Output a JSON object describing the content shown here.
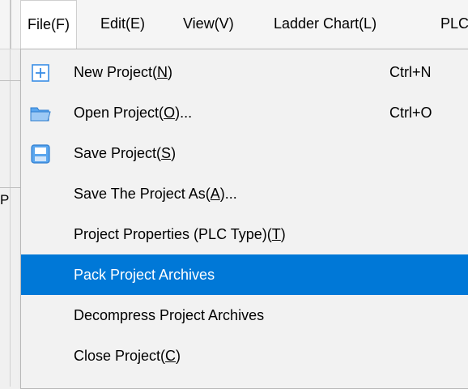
{
  "menubar": {
    "items": [
      {
        "label": "File(F)"
      },
      {
        "label": "Edit(E)"
      },
      {
        "label": "View(V)"
      },
      {
        "label": "Ladder Chart(L)"
      },
      {
        "label": "PLC"
      }
    ]
  },
  "background": {
    "letter": "P"
  },
  "file_menu": {
    "items": [
      {
        "label": "New Project(",
        "key": "N",
        "suffix": ")",
        "shortcut": "Ctrl+N",
        "icon": "new-project-icon"
      },
      {
        "label": "Open Project(",
        "key": "O",
        "suffix": ")...",
        "shortcut": "Ctrl+O",
        "icon": "folder-open-icon"
      },
      {
        "label": "Save Project(",
        "key": "S",
        "suffix": ")",
        "shortcut": "",
        "icon": "save-icon"
      },
      {
        "label": "Save The Project As(",
        "key": "A",
        "suffix": ")...",
        "shortcut": ""
      },
      {
        "label": "Project Properties (PLC Type)(",
        "key": "T",
        "suffix": ")",
        "shortcut": ""
      },
      {
        "label": "Pack Project Archives",
        "key": "",
        "suffix": "",
        "shortcut": "",
        "highlighted": true
      },
      {
        "label": "Decompress Project Archives",
        "key": "",
        "suffix": "",
        "shortcut": ""
      },
      {
        "label": "Close Project(",
        "key": "C",
        "suffix": ")",
        "shortcut": ""
      }
    ]
  },
  "colors": {
    "highlight": "#0078d7",
    "icon_blue": "#3a8ee6"
  }
}
